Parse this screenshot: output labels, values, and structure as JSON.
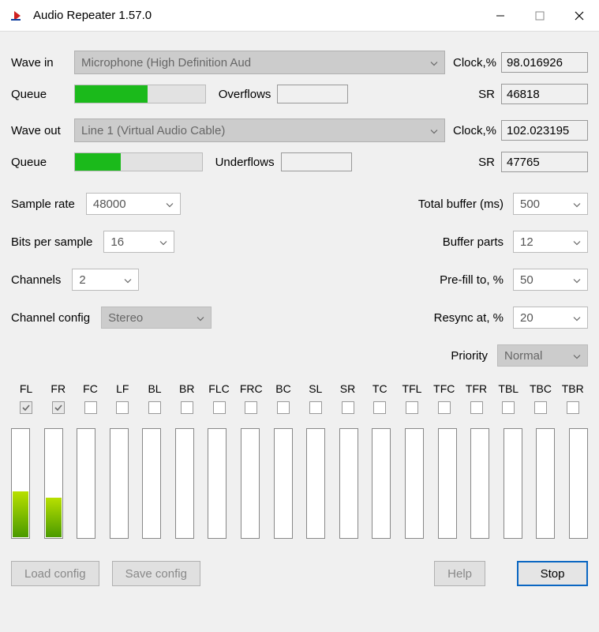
{
  "window": {
    "title": "Audio Repeater 1.57.0"
  },
  "wave_in": {
    "label": "Wave in",
    "device": "Microphone (High Definition Aud",
    "clock_label": "Clock,%",
    "clock_value": "98.016926",
    "queue_label": "Queue",
    "queue_pct": 56,
    "overflows_label": "Overflows",
    "sr_label": "SR",
    "sr_value": "46818"
  },
  "wave_out": {
    "label": "Wave out",
    "device": "Line 1 (Virtual Audio Cable)",
    "clock_label": "Clock,%",
    "clock_value": "102.023195",
    "queue_label": "Queue",
    "queue_pct": 36,
    "underflows_label": "Underflows",
    "sr_label": "SR",
    "sr_value": "47765"
  },
  "settings": {
    "sample_rate": {
      "label": "Sample rate",
      "value": "48000"
    },
    "bits_per_sample": {
      "label": "Bits per sample",
      "value": "16"
    },
    "channels": {
      "label": "Channels",
      "value": "2"
    },
    "channel_config": {
      "label": "Channel config",
      "value": "Stereo"
    },
    "total_buffer": {
      "label": "Total buffer (ms)",
      "value": "500"
    },
    "buffer_parts": {
      "label": "Buffer parts",
      "value": "12"
    },
    "pre_fill": {
      "label": "Pre-fill to, %",
      "value": "50"
    },
    "resync": {
      "label": "Resync at, %",
      "value": "20"
    },
    "priority": {
      "label": "Priority",
      "value": "Normal"
    }
  },
  "channels_list": [
    "FL",
    "FR",
    "FC",
    "LF",
    "BL",
    "BR",
    "FLC",
    "FRC",
    "BC",
    "SL",
    "SR",
    "TC",
    "TFL",
    "TFC",
    "TFR",
    "TBL",
    "TBC",
    "TBR"
  ],
  "channels_checked": [
    true,
    true,
    false,
    false,
    false,
    false,
    false,
    false,
    false,
    false,
    false,
    false,
    false,
    false,
    false,
    false,
    false,
    false
  ],
  "meters_pct": [
    42,
    36,
    0,
    0,
    0,
    0,
    0,
    0,
    0,
    0,
    0,
    0,
    0,
    0,
    0,
    0,
    0,
    0
  ],
  "buttons": {
    "load": "Load config",
    "save": "Save config",
    "help": "Help",
    "stop": "Stop"
  }
}
